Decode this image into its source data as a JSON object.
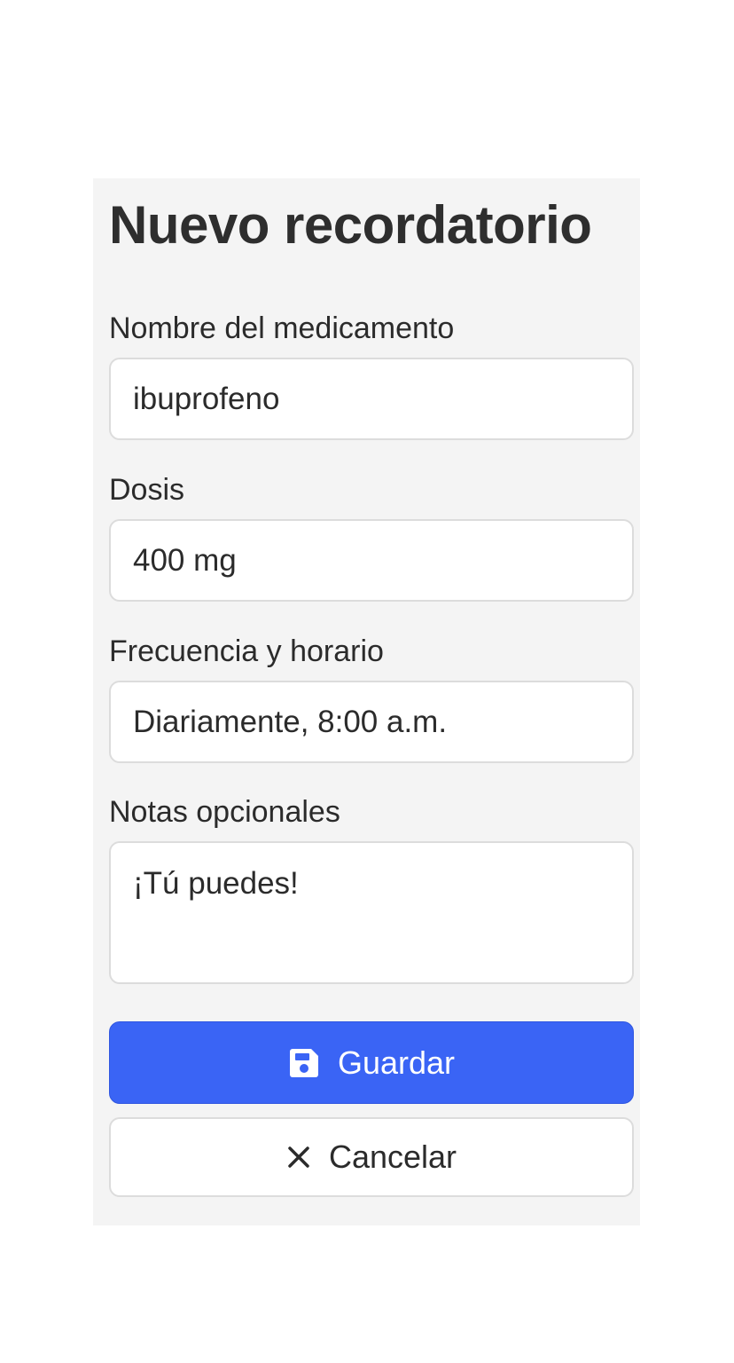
{
  "form": {
    "title": "Nuevo recordatorio",
    "fields": [
      {
        "label": "Nombre del medicamento",
        "value": "ibuprofeno"
      },
      {
        "label": "Dosis",
        "value": "400 mg"
      },
      {
        "label": "Frecuencia y horario",
        "value": "Diariamente, 8:00 a.m."
      },
      {
        "label": "Notas opcionales",
        "value": "¡Tú puedes!"
      }
    ],
    "save_label": "Guardar",
    "save_icon": "save-icon",
    "cancel_label": "Cancelar",
    "cancel_icon": "close-icon"
  },
  "colors": {
    "accent": "#3a64f5",
    "panel_background": "#f4f4f4"
  }
}
